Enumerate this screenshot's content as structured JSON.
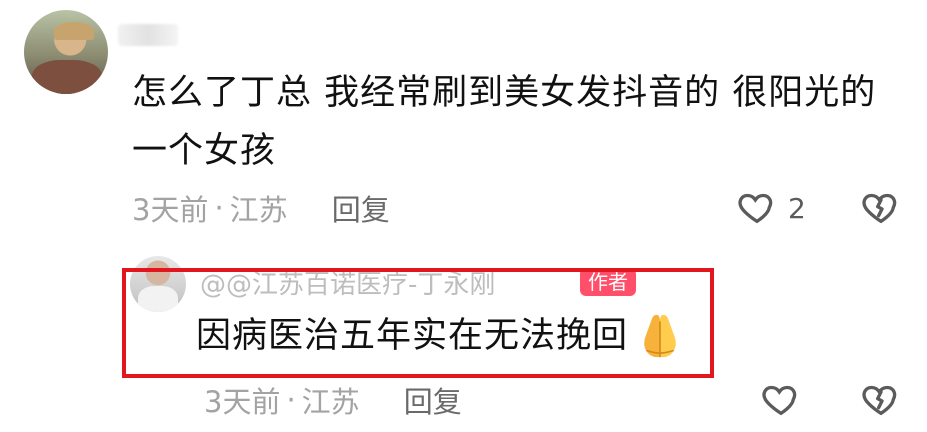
{
  "comment": {
    "avatar_icon": "avatar-icon",
    "text": "怎么了丁总 我经常刷到美女发抖音的 很阳光的一个女孩",
    "meta": {
      "time": "3天前",
      "separator": "·",
      "location": "江苏",
      "reply_label": "回复"
    },
    "likes_count": "2",
    "icons": {
      "like": "heart-icon",
      "dislike": "broken-heart-icon"
    }
  },
  "reply": {
    "avatar_icon": "avatar-icon",
    "user": "@@江苏百诺医疗-丁永刚",
    "badge": "作者",
    "text": "因病医治五年实在无法挽回",
    "emoji": "🙏",
    "meta": {
      "time": "3天前",
      "separator": "·",
      "location": "江苏",
      "reply_label": "回复"
    },
    "icons": {
      "like": "heart-icon",
      "dislike": "broken-heart-icon"
    }
  },
  "colors": {
    "text_primary": "#111111",
    "text_secondary": "#8a8a8a",
    "badge_bg": "#ff4f6b",
    "highlight_border": "#e1161f"
  }
}
